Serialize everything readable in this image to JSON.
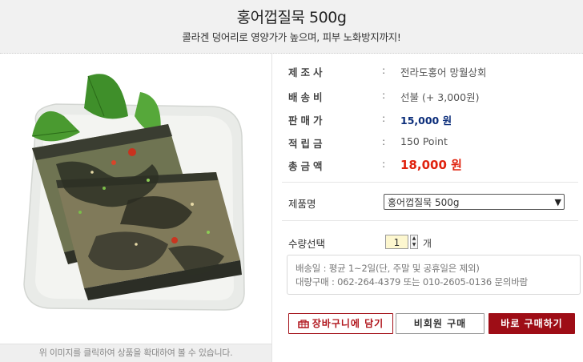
{
  "header": {
    "title": "홍어껍질묵 500g",
    "subtitle": "콜라겐 덩어리로 영양가가 높으며, 피부 노화방지까지!"
  },
  "image_panel": {
    "caption": "위 이미지를 클릭하여 상품을 확대하여 볼 수 있습니다."
  },
  "info_rows": [
    {
      "label": "제조사",
      "value": "전라도홍어 망월상회"
    },
    {
      "label": "배송비",
      "value": "선불 (+ 3,000원)"
    },
    {
      "label": "판매가",
      "value": "15,000 원"
    },
    {
      "label": "적립금",
      "value": "150 Point"
    },
    {
      "label": "총금액",
      "value": "18,000 원"
    }
  ],
  "options": {
    "product_label": "제품명",
    "product_selected": "홍어껍질묵 500g",
    "qty_label": "수량선택",
    "qty_value": "1",
    "qty_unit": "개"
  },
  "notice": {
    "line1": "배송일 : 평균 1~2일(단, 주말 및 공휴일은 제외)",
    "line2": "대량구매 : 062-264-4379 또는 010-2605-0136 문의바람"
  },
  "buttons": {
    "cart": "장바구니에 담기",
    "guest": "비회원 구매",
    "buy": "바로 구매하기"
  },
  "colors": {
    "price": "#0b2d7a",
    "total": "#e0220e",
    "accent": "#9e0d16"
  },
  "icons": [
    "cart-icon",
    "chevron-down-icon",
    "spinner-up-icon",
    "spinner-down-icon"
  ]
}
